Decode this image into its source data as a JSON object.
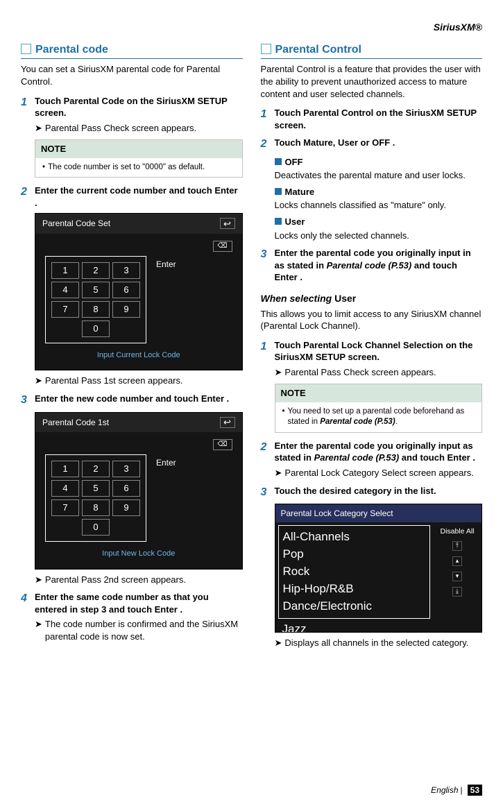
{
  "header": {
    "brand": "SiriusXM®"
  },
  "left": {
    "heading": "Parental code",
    "intro": "You can set a SiriusXM parental code for Parental Control.",
    "steps": [
      {
        "num": "1",
        "prefix": "Touch ",
        "token": "Parental Code",
        "suffix": " on the SiriusXM SETUP screen."
      },
      {
        "num": "2",
        "prefix": "Enter the current code number and touch ",
        "token": "Enter",
        "suffix": " ."
      },
      {
        "num": "3",
        "prefix": "Enter the new code number and touch ",
        "token": "Enter",
        "suffix": " ."
      },
      {
        "num": "4",
        "prefix": "Enter the same code number as that you entered in step 3 and touch ",
        "token": "Enter",
        "suffix": " ."
      }
    ],
    "result1": "Parental Pass Check screen appears.",
    "note1": {
      "title": "NOTE",
      "item": "The code number is set to \"0000\" as default."
    },
    "ss1": {
      "title": "Parental Code Set",
      "caption": "Input Current Lock Code",
      "enter": "Enter",
      "keys": [
        "1",
        "2",
        "3",
        "4",
        "5",
        "6",
        "7",
        "8",
        "9",
        "0"
      ],
      "bs": "⌫"
    },
    "result2": "Parental Pass 1st screen appears.",
    "ss2": {
      "title": "Parental Code 1st",
      "caption": "Input New Lock Code",
      "enter": "Enter",
      "keys": [
        "1",
        "2",
        "3",
        "4",
        "5",
        "6",
        "7",
        "8",
        "9",
        "0"
      ],
      "bs": "⌫"
    },
    "result3": "Parental Pass 2nd screen appears.",
    "result4": "The code number is confirmed and the SiriusXM parental code is now set."
  },
  "right": {
    "heading": "Parental Control",
    "intro": "Parental Control is a feature that provides the user with the ability to prevent unauthorized access to mature content and user selected channels.",
    "step1": {
      "num": "1",
      "prefix": "Touch ",
      "token": "Parental Control",
      "suffix": " on the SiriusXM SETUP screen."
    },
    "step2": {
      "num": "2",
      "prefix": "Touch ",
      "t1": "Mature",
      "c1": ", ",
      "t2": "User",
      "c2": " or ",
      "t3": "OFF",
      "suffix": " ."
    },
    "opts": [
      {
        "title": "OFF",
        "desc": "Deactivates the parental mature and user locks."
      },
      {
        "title": "Mature",
        "desc": "Locks channels classified as \"mature\" only."
      },
      {
        "title": "User",
        "desc": "Locks only the selected channels."
      }
    ],
    "step3": {
      "num": "3",
      "line1": "Enter the parental code you originally input in as stated in ",
      "ref": "Parental code (P.53)",
      "line2": " and touch ",
      "token": "Enter",
      "suffix": " ."
    },
    "subhead": {
      "prefix": "When selecting ",
      "token": "User"
    },
    "subintro": "This allows you to limit access to any SiriusXM channel (Parental Lock Channel).",
    "ustep1": {
      "num": "1",
      "prefix": "Touch ",
      "token": "Parental Lock Channel Selection",
      "suffix": " on the SiriusXM SETUP screen."
    },
    "uresult1": "Parental Pass Check screen appears.",
    "unote": {
      "title": "NOTE",
      "line1": "You need to set up a parental code beforehand as stated in ",
      "ref": "Parental code (P.53)",
      "line2": "."
    },
    "ustep2": {
      "num": "2",
      "line1": "Enter the parental code you originally input as stated in ",
      "ref": "Parental code (P.53)",
      "line2": " and touch ",
      "token": "Enter",
      "suffix": " ."
    },
    "uresult2": "Parental Lock Category Select screen appears.",
    "ustep3": {
      "num": "3",
      "text": "Touch the desired category in the list."
    },
    "catss": {
      "title": "Parental Lock Category Select",
      "items": [
        "All-Channels",
        "Pop",
        "Rock",
        "Hip-Hop/R&B",
        "Dance/Electronic"
      ],
      "cut": "Jazz",
      "disable": "Disable All"
    },
    "uresult3": "Displays all channels in the selected category."
  },
  "footer": {
    "lang": "English",
    "page": "53"
  }
}
